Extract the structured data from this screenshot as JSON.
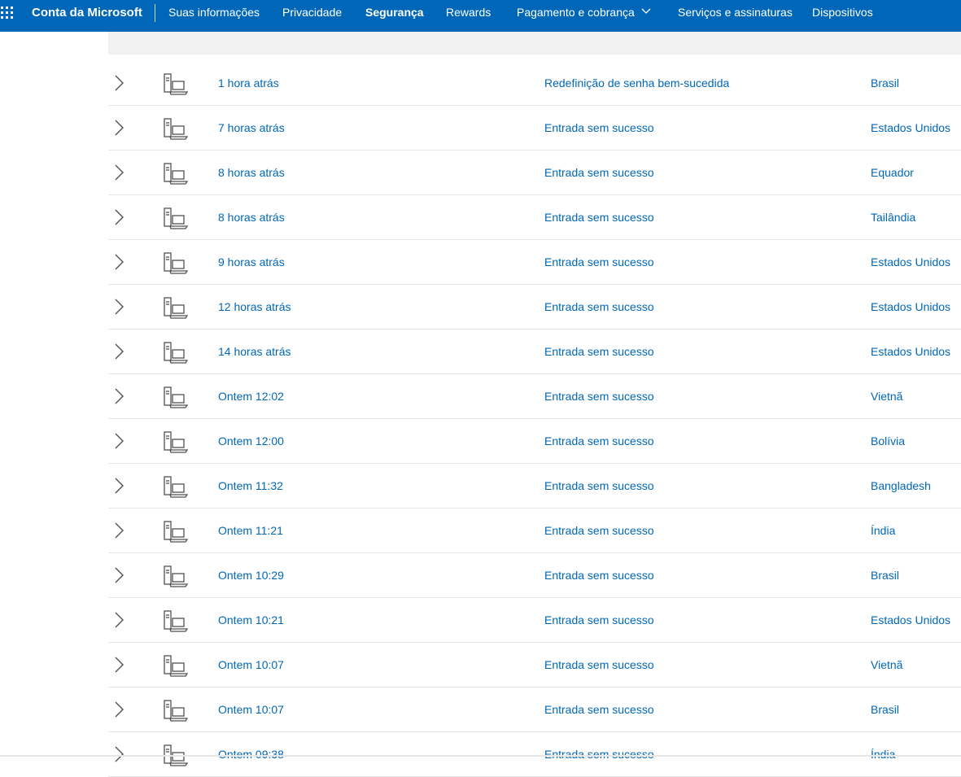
{
  "header": {
    "brand": "Conta da Microsoft",
    "nav": [
      {
        "label": "Suas informações"
      },
      {
        "label": "Privacidade"
      },
      {
        "label": "Segurança",
        "active": true
      },
      {
        "label": "Rewards"
      },
      {
        "label": "Pagamento e cobrança",
        "dropdown": true
      },
      {
        "label": "Serviços e assinaturas"
      },
      {
        "label": "Dispositivos"
      }
    ]
  },
  "colors": {
    "header_bg": "#0067b8",
    "link": "#0067b8",
    "strip_bg": "#f2f2f2",
    "divider": "#e6e6e6"
  },
  "icons": {
    "row_expand": "chevron-right-icon",
    "device": "device-icon",
    "app_launcher": "waffle-icon"
  },
  "activity": {
    "rows": [
      {
        "time": "1 hora atrás",
        "activity": "Redefinição de senha bem-sucedida",
        "country": "Brasil"
      },
      {
        "time": "7 horas atrás",
        "activity": "Entrada sem sucesso",
        "country": "Estados Unidos"
      },
      {
        "time": "8 horas atrás",
        "activity": "Entrada sem sucesso",
        "country": "Equador"
      },
      {
        "time": "8 horas atrás",
        "activity": "Entrada sem sucesso",
        "country": "Tailândia"
      },
      {
        "time": "9 horas atrás",
        "activity": "Entrada sem sucesso",
        "country": "Estados Unidos"
      },
      {
        "time": "12 horas atrás",
        "activity": "Entrada sem sucesso",
        "country": "Estados Unidos"
      },
      {
        "time": "14 horas atrás",
        "activity": "Entrada sem sucesso",
        "country": "Estados Unidos"
      },
      {
        "time": "Ontem 12:02",
        "activity": "Entrada sem sucesso",
        "country": "Vietnã"
      },
      {
        "time": "Ontem 12:00",
        "activity": "Entrada sem sucesso",
        "country": "Bolívia"
      },
      {
        "time": "Ontem 11:32",
        "activity": "Entrada sem sucesso",
        "country": "Bangladesh"
      },
      {
        "time": "Ontem 11:21",
        "activity": "Entrada sem sucesso",
        "country": "Índia"
      },
      {
        "time": "Ontem 10:29",
        "activity": "Entrada sem sucesso",
        "country": "Brasil"
      },
      {
        "time": "Ontem 10:21",
        "activity": "Entrada sem sucesso",
        "country": "Estados Unidos"
      },
      {
        "time": "Ontem 10:07",
        "activity": "Entrada sem sucesso",
        "country": "Vietnã"
      },
      {
        "time": "Ontem 10:07",
        "activity": "Entrada sem sucesso",
        "country": "Brasil"
      },
      {
        "time": "Ontem 09:38",
        "activity": "Entrada sem sucesso",
        "country": "Índia"
      }
    ]
  }
}
